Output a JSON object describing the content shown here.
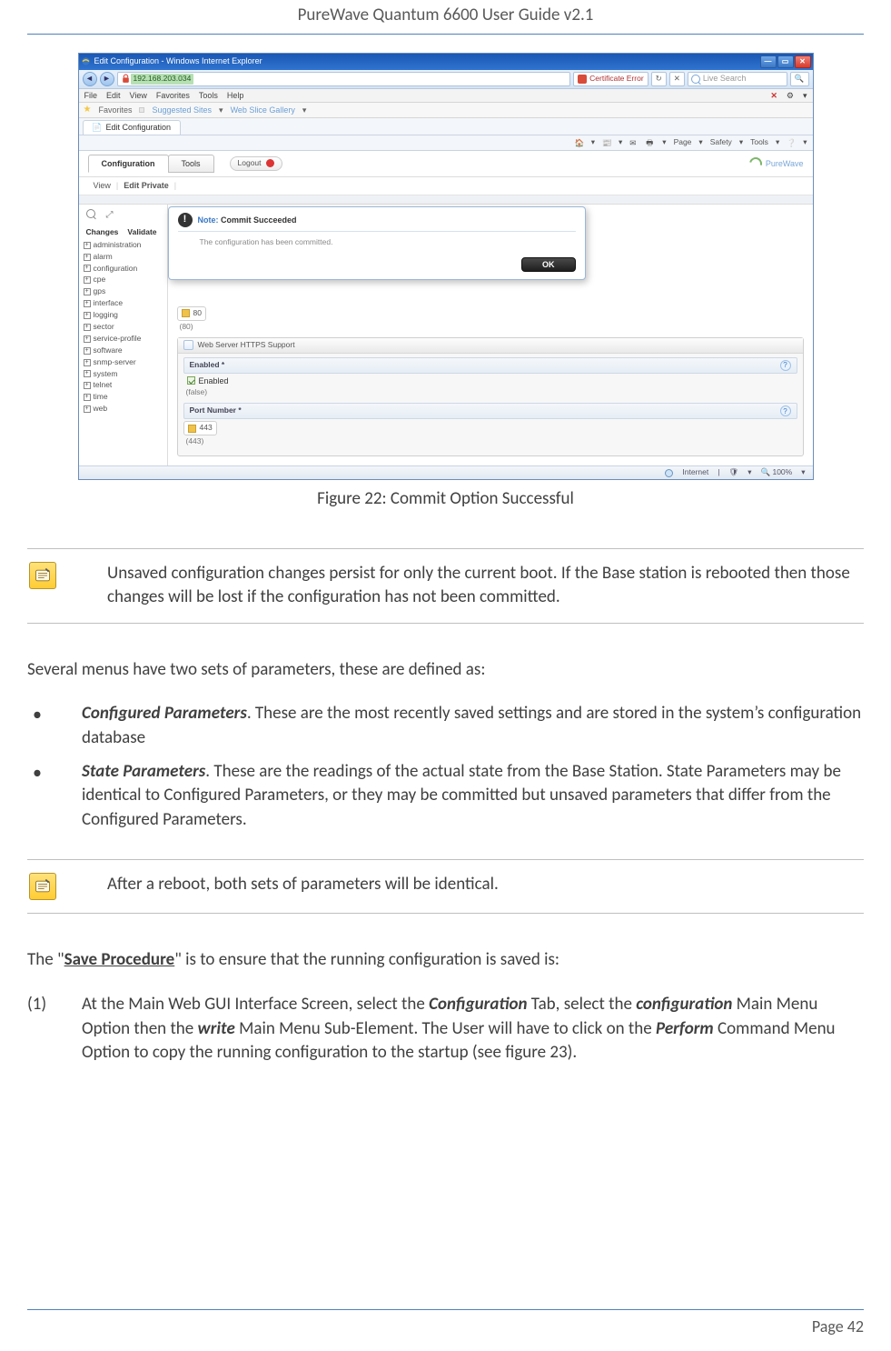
{
  "header": "PureWave Quantum 6600 User Guide v2.1",
  "footer": "Page 42",
  "figure_caption": "Figure 22: Commit Option Successful",
  "note1": "Unsaved configuration changes persist for only the current boot.  If the Base station is rebooted then those changes will be lost if the configuration has not been committed.",
  "para_intro": "Several menus have two sets of parameters, these are defined as:",
  "bullet1_lead": "Configured Parameters",
  "bullet1_rest": ". These are the most recently saved settings and are stored in the system’s configuration database",
  "bullet2_lead": "State Parameters",
  "bullet2_rest": ". These are the readings of the actual state from the Base Station.   State Parameters may be identical to Configured Parameters, or they may be committed but unsaved parameters that differ from the Configured Parameters.",
  "note2": "After a reboot, both sets of parameters will be identical.",
  "save_pre": "The \"",
  "save_link": "Save Procedure",
  "save_post": "\" is to ensure that the running configuration is saved is:",
  "step1_num": "(1)",
  "step1_a": "At the Main Web GUI Interface Screen, select the ",
  "step1_b": "Configuration",
  "step1_c": " Tab, select the ",
  "step1_d": "configuration",
  "step1_e": " Main Menu Option then the ",
  "step1_f": "write",
  "step1_g": " Main Menu Sub-Element. The User will have to click on the ",
  "step1_h": "Perform",
  "step1_i": " Command Menu Option to copy the running configuration to the startup (see figure 23).",
  "ie": {
    "title": "Edit Configuration - Windows Internet Explorer",
    "url": "192.168.203.034",
    "cert_error": "Certificate Error",
    "search_ph": "Live Search",
    "menu": {
      "file": "File",
      "edit": "Edit",
      "view": "View",
      "favorites": "Favorites",
      "tools": "Tools",
      "help": "Help"
    },
    "favorites": "Favorites",
    "sugg": "Suggested Sites",
    "sugg2": "Web Slice Gallery",
    "tab_title": "Edit Configuration",
    "cmds": {
      "page": "Page",
      "safety": "Safety",
      "tools": "Tools"
    },
    "status_internet": "Internet",
    "status_zoom": "100%"
  },
  "app": {
    "tab_config": "Configuration",
    "tab_tools": "Tools",
    "logout": "Logout",
    "brand": "PureWave",
    "view": "View",
    "edit_private": "Edit Private",
    "changes": "Changes",
    "validate": "Validate",
    "tree": [
      "administration",
      "alarm",
      "configuration",
      "cpe",
      "gps",
      "interface",
      "logging",
      "sector",
      "service-profile",
      "software",
      "snmp-server",
      "system",
      "telnet",
      "time",
      "web"
    ],
    "dialog": {
      "note": "Note:",
      "title": " Commit Succeeded",
      "body": "The configuration has been committed.",
      "ok": "OK"
    },
    "form": {
      "val80": "80",
      "val80_hint": "(80)",
      "panel_title": "Web Server HTTPS Support",
      "enabled_label": "Enabled *",
      "enabled_chk": "Enabled",
      "enabled_hint": "(false)",
      "port_label": "Port Number *",
      "port_val": "443",
      "port_hint": "(443)"
    }
  }
}
